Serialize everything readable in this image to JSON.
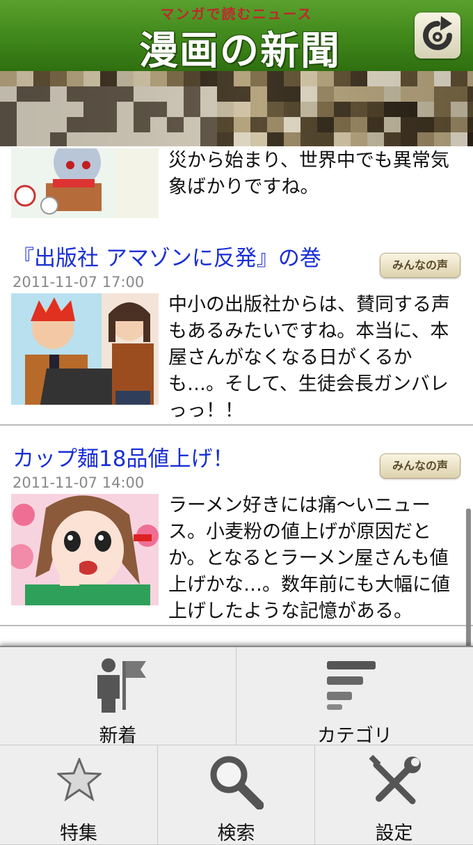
{
  "header": {
    "tagline": "マンガで読むニュース",
    "logo": "漫画の新聞"
  },
  "icons": {
    "refresh": "refresh-icon",
    "new": "person-with-flag-icon",
    "category": "category-list-icon",
    "feature": "star-icon",
    "search": "magnifier-icon",
    "settings": "wrench-screwdriver-icon"
  },
  "colors": {
    "header_green": "#3d8419",
    "title_blue": "#1a2fd6",
    "tagline_red": "#c0272d"
  },
  "feed": {
    "items": [
      {
        "body": "災から始まり、世界中でも異常気象ばかりですね。"
      },
      {
        "title": "『出版社 アマゾンに反発』の巻",
        "date": "2011-11-07 17:00",
        "voice": "みんなの声",
        "body": "中小の出版社からは、賛同する声もあるみたいですね。本当に、本屋さんがなくなる日がくるかも…。そして、生徒会長ガンバレっっ！！"
      },
      {
        "title": "カップ麺18品値上げ！",
        "date": "2011-11-07 14:00",
        "voice": "みんなの声",
        "body": "ラーメン好きには痛〜いニュース。小麦粉の値上げが原因だとか。となるとラーメン屋さんも値上げかな…。数年前にも大幅に値上げしたような記憶がある。"
      }
    ]
  },
  "menu": {
    "new_label": "新着",
    "category_label": "カテゴリ",
    "feature_label": "特集",
    "search_label": "検索",
    "settings_label": "設定"
  }
}
